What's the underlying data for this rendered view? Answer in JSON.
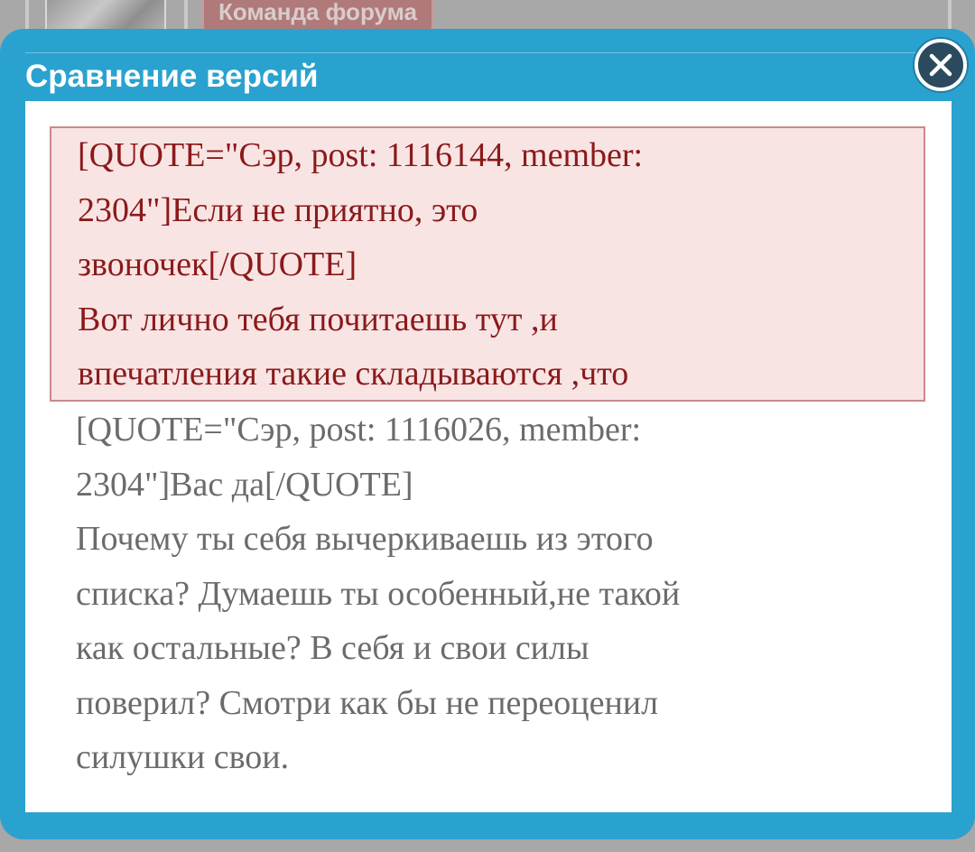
{
  "background": {
    "badge_label": "Команда форума"
  },
  "dialog": {
    "title": "Сравнение версий",
    "close_icon": "close-icon"
  },
  "diff": {
    "removed_lines": "[QUOTE=\"Сэр, post: 1116144, member:\n2304\"]Если не приятно, это\nзвоночек[/QUOTE]\nВот лично тебя почитаешь тут ,и\nвпечатления такие складываются ,что",
    "unchanged_lines": "[QUOTE=\"Сэр, post: 1116026, member:\n2304\"]Вас да[/QUOTE]\nПочему ты себя вычеркиваешь из этого\nсписка? Думаешь ты особенный,не такой\nкак остальные? В себя и свои силы\nповерил? Смотри как бы не переоценил\nсилушки свои."
  },
  "colors": {
    "accent": "#2aa2cf",
    "removed_bg": "#f9e4e4",
    "removed_border": "#c98a8a",
    "removed_text": "#8b1a1a",
    "unchanged_text": "#6b6b6b"
  }
}
